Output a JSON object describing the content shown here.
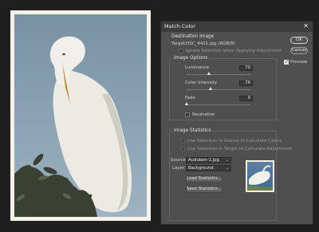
{
  "dialog": {
    "title": "Match Color",
    "close_symbol": "✕",
    "destination": {
      "section_label": "Destination Image",
      "target_prefix": "Target:",
      "target_value": "DSC_4421.jpg (RGB/8)",
      "ignore_selection_label": "Ignore Selection when Applying Adjustment"
    },
    "options": {
      "section_label": "Image Options",
      "luminance_label": "Luminance",
      "luminance_value": "70",
      "luminance_level": 0.35,
      "intensity_label": "Color Intensity",
      "intensity_value": "76",
      "intensity_level": 0.38,
      "fade_label": "Fade",
      "fade_value": "0",
      "fade_level": 0,
      "neutralize_label": "Neutralize"
    },
    "statistics": {
      "section_label": "Image Statistics",
      "use_source_label": "Use Selection in Source to Calculate Colors",
      "use_target_label": "Use Selection in Target to Calculate Adjustment",
      "source_label": "Source:",
      "source_value": "Audubon-1.jpg",
      "layer_label": "Layer:",
      "layer_value": "Background",
      "load_button": "Load Statistics...",
      "save_button": "Save Statistics..."
    },
    "ok_button": "OK",
    "cancel_button": "Cancel",
    "preview_label": "Preview"
  }
}
